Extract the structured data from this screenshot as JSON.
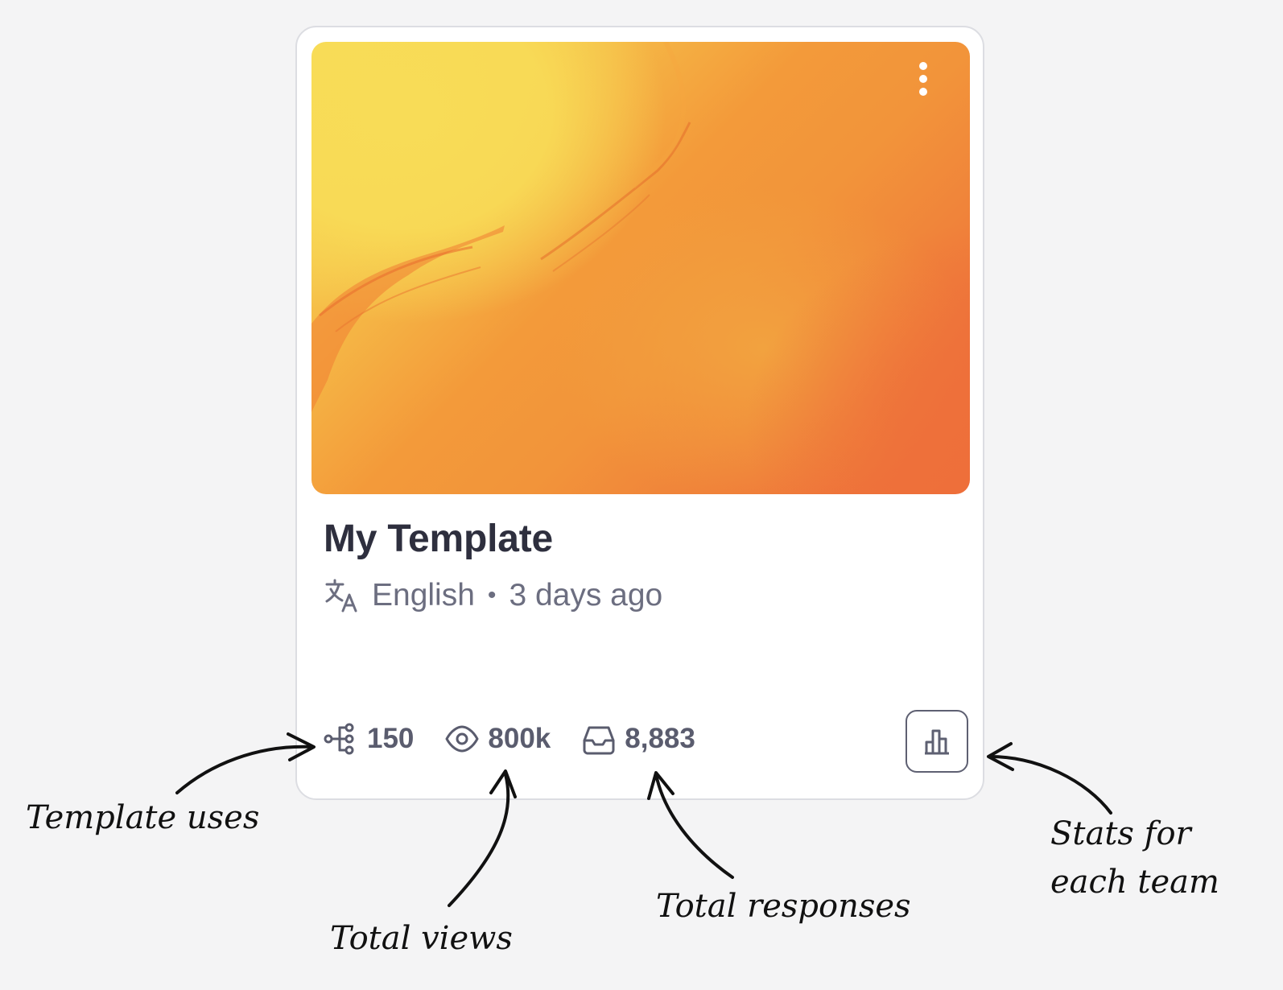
{
  "card": {
    "title": "My Template",
    "language": "English",
    "separator": "•",
    "updated": "3 days ago",
    "cover_colors": [
      "#f8da55",
      "#f39a3a",
      "#ee6e3b"
    ]
  },
  "stats": {
    "uses": "150",
    "views": "800k",
    "responses": "8,883"
  },
  "icons": {
    "more": "more-vertical-icon",
    "language": "translate-icon",
    "uses": "branch-tree-icon",
    "views": "eye-icon",
    "responses": "inbox-tray-icon",
    "team_stats": "bar-chart-icon"
  },
  "annotations": {
    "uses": "Template uses",
    "views": "Total views",
    "responses": "Total responses",
    "team_line1": "Stats for",
    "team_line2": "each team"
  }
}
